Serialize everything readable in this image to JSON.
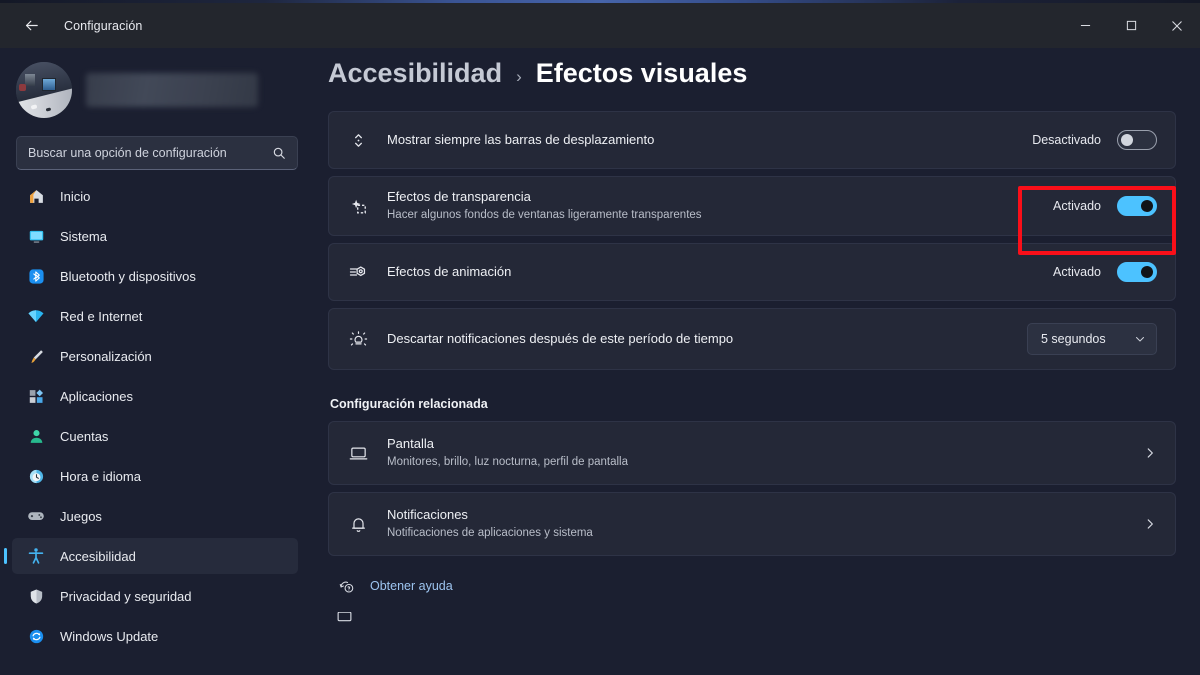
{
  "window": {
    "title": "Configuración",
    "back_icon": "back-arrow-icon",
    "minimize_label": "—",
    "maximize_label": "□",
    "close_label": "✕"
  },
  "sidebar": {
    "account": {
      "avatar_icon": "user-avatar-photo",
      "name_redacted": ""
    },
    "search": {
      "placeholder": "Buscar una opción de configuración",
      "value": "",
      "icon": "search-icon"
    },
    "items": [
      {
        "label": "Inicio",
        "icon": "home-icon",
        "active": false
      },
      {
        "label": "Sistema",
        "icon": "system-monitor-icon",
        "active": false
      },
      {
        "label": "Bluetooth y dispositivos",
        "icon": "bluetooth-icon",
        "active": false
      },
      {
        "label": "Red e Internet",
        "icon": "wifi-icon",
        "active": false
      },
      {
        "label": "Personalización",
        "icon": "paintbrush-icon",
        "active": false
      },
      {
        "label": "Aplicaciones",
        "icon": "apps-icon",
        "active": false
      },
      {
        "label": "Cuentas",
        "icon": "account-person-icon",
        "active": false
      },
      {
        "label": "Hora e idioma",
        "icon": "clock-globe-icon",
        "active": false
      },
      {
        "label": "Juegos",
        "icon": "gamepad-icon",
        "active": false
      },
      {
        "label": "Accesibilidad",
        "icon": "accessibility-person-icon",
        "active": true
      },
      {
        "label": "Privacidad y seguridad",
        "icon": "shield-icon",
        "active": false
      },
      {
        "label": "Windows Update",
        "icon": "update-refresh-icon",
        "active": false
      }
    ]
  },
  "breadcrumb": {
    "parent": "Accesibilidad",
    "separator": "›",
    "current": "Efectos visuales"
  },
  "settings": [
    {
      "icon": "scrollbar-arrows-icon",
      "title": "Mostrar siempre las barras de desplazamiento",
      "subtitle": "",
      "control": "toggle",
      "state_label": "Desactivado",
      "state_on": false
    },
    {
      "icon": "transparency-sparkle-icon",
      "title": "Efectos de transparencia",
      "subtitle": "Hacer algunos fondos de ventanas ligeramente transparentes",
      "control": "toggle",
      "state_label": "Activado",
      "state_on": true,
      "highlighted": true
    },
    {
      "icon": "animation-motion-icon",
      "title": "Efectos de animación",
      "subtitle": "",
      "control": "toggle",
      "state_label": "Activado",
      "state_on": true
    },
    {
      "icon": "notification-brightness-icon",
      "title": "Descartar notificaciones después de este período de tiempo",
      "subtitle": "",
      "control": "dropdown",
      "state_label": "5 segundos",
      "dropdown_icon": "chevron-down-icon"
    }
  ],
  "related": {
    "heading": "Configuración relacionada",
    "items": [
      {
        "icon": "display-monitor-icon",
        "title": "Pantalla",
        "subtitle": "Monitores, brillo, luz nocturna, perfil de pantalla",
        "chevron": "chevron-right-icon"
      },
      {
        "icon": "bell-icon",
        "title": "Notificaciones",
        "subtitle": "Notificaciones de aplicaciones y sistema",
        "chevron": "chevron-right-icon"
      }
    ]
  },
  "footer": {
    "help_label": "Obtener ayuda",
    "help_icon": "help-question-icon",
    "partial_icon": "feedback-icon"
  },
  "colors": {
    "accent": "#4cc2ff",
    "annotation": "#fa0f19",
    "background": "#1b1f30",
    "card": "#242837",
    "titlebar": "#23262d",
    "link": "#9dc4ef"
  }
}
